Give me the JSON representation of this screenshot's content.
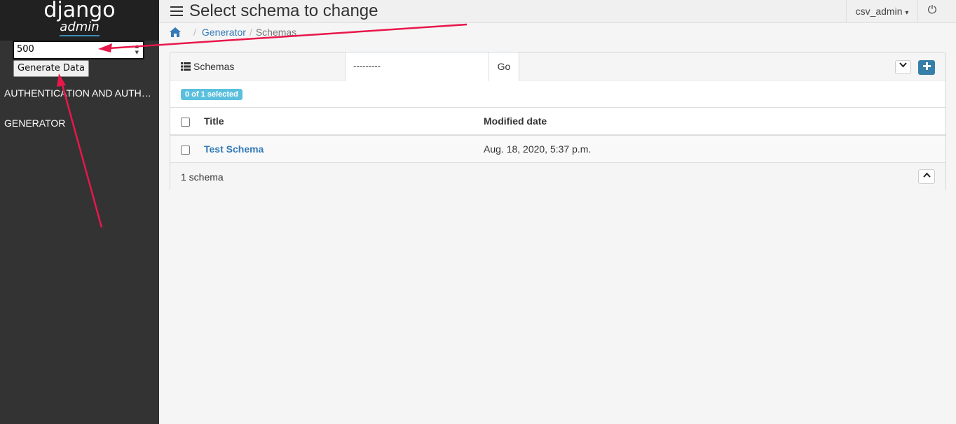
{
  "sidebar": {
    "logo_line1": "django",
    "logo_line2": "admin",
    "form": {
      "input_value": "500",
      "button_label": "Generate Data"
    },
    "items": [
      {
        "label": "AUTHENTICATION AND AUTHORIZATION"
      },
      {
        "label": "GENERATOR"
      }
    ]
  },
  "header": {
    "title": "Select schema to change",
    "user": "csv_admin",
    "caret": "▾",
    "power": "⏻"
  },
  "breadcrumb": {
    "items": [
      "Generator",
      "Schemas"
    ],
    "sep": "/"
  },
  "changelist": {
    "title": "Schemas",
    "action_value": "---------",
    "go_label": "Go",
    "selected_badge": "0 of 1 selected",
    "columns": [
      "Title",
      "Modified date"
    ],
    "rows": [
      {
        "title": "Test Schema",
        "modified": "Aug. 18, 2020, 5:37 p.m."
      }
    ],
    "footer": "1 schema"
  },
  "colors": {
    "sidebar_bg": "#333333",
    "logo_bg": "#212121",
    "link": "#337ab7",
    "badge": "#5bc0de",
    "add_button": "#367fa9",
    "annotation_arrow": "#e8174a"
  },
  "icons": {
    "home": "home-icon",
    "list": "list-icon",
    "collapse": "chevron-down-icon",
    "add": "plus-icon",
    "expand": "chevron-up-icon",
    "menu": "hamburger-icon",
    "power": "power-icon"
  }
}
